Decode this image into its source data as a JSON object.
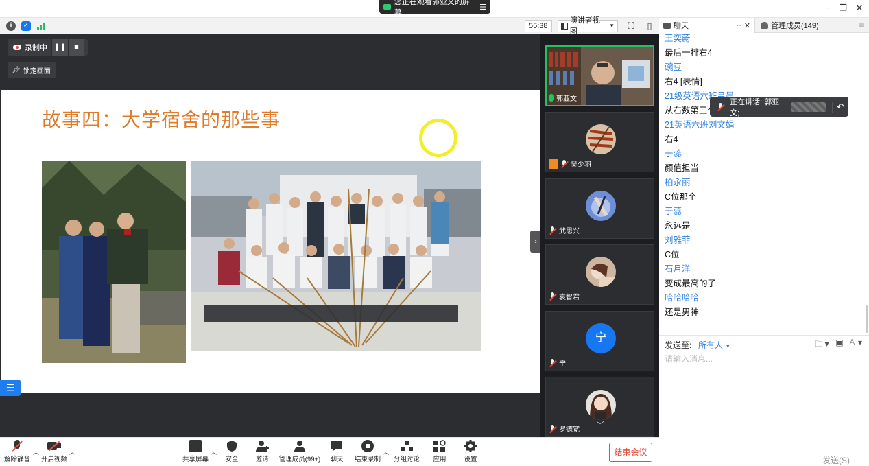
{
  "topbar": {
    "sharing_banner": "您正在观看郭亚文的屏幕",
    "window_buttons": [
      "−",
      "❐",
      "✕"
    ]
  },
  "infobar": {
    "timer": "55:38",
    "view_mode": "演讲者视图"
  },
  "chat_tabs": {
    "chat": "聊天",
    "chat_more": "···",
    "chat_close": "✕",
    "members": "管理成员(149)",
    "menu": "≡"
  },
  "stage": {
    "recording_label": "录制中",
    "lock_label": "锁定画面",
    "slide_title": "故事四：大学宿舍的那些事"
  },
  "videos": {
    "tiles": [
      {
        "name": "郭亚文"
      },
      {
        "name": "吴少羽"
      },
      {
        "name": "武思兴"
      },
      {
        "name": "袁智君"
      },
      {
        "name": "宁",
        "avatar_text": "宁",
        "avatar_color": "#1677f0"
      },
      {
        "name": "罗德宽"
      }
    ]
  },
  "chat": {
    "messages": [
      {
        "type": "name",
        "text": "王奕蔚"
      },
      {
        "type": "text",
        "text": "最后一排右4"
      },
      {
        "type": "name",
        "text": "豌豆"
      },
      {
        "type": "text",
        "text": "右4 [表情]"
      },
      {
        "type": "name",
        "text": "21级英语六班吕晨"
      },
      {
        "type": "text",
        "text": "从右数第三个"
      },
      {
        "type": "name",
        "text": "21英语六班刘文娟"
      },
      {
        "type": "text",
        "text": "右4"
      },
      {
        "type": "name",
        "text": "于蕊"
      },
      {
        "type": "text",
        "text": "颜值担当"
      },
      {
        "type": "name",
        "text": "柏永丽"
      },
      {
        "type": "text",
        "text": "C位那个"
      },
      {
        "type": "name",
        "text": "于蕊"
      },
      {
        "type": "text",
        "text": "永远是"
      },
      {
        "type": "name",
        "text": "刘雅菲"
      },
      {
        "type": "text",
        "text": "C位"
      },
      {
        "type": "name",
        "text": "石月洋"
      },
      {
        "type": "text",
        "text": "变成最高的了"
      },
      {
        "type": "name",
        "text": "哈哈哈哈"
      },
      {
        "type": "text",
        "text": "还是男神"
      }
    ],
    "speaking_label": "正在讲话: 郭亚文;",
    "send_to_label": "发送至:",
    "send_to_target": "所有人",
    "input_placeholder": "请输入消息...",
    "send_button": "发送(S)"
  },
  "toolbar": {
    "unmute": "解除静音",
    "start_video": "开启视频",
    "share_screen": "共享屏幕",
    "security": "安全",
    "invite": "邀请",
    "manage_members": "管理成员(99+)",
    "chat": "聊天",
    "end_recording": "结束录制",
    "breakout": "分组讨论",
    "apps": "应用",
    "settings": "设置",
    "end_meeting": "结束会议"
  }
}
